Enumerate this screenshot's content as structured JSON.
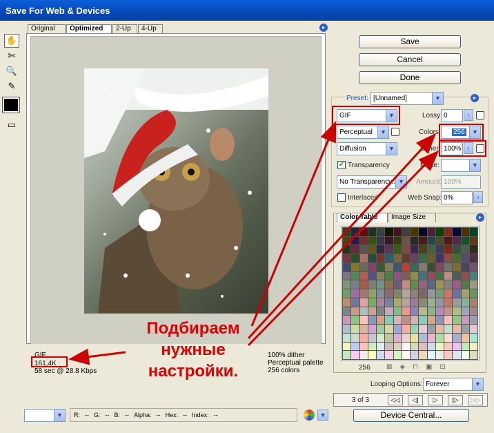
{
  "window": {
    "title": "Save For Web & Devices"
  },
  "tabs": [
    "Original",
    "Optimized",
    "2-Up",
    "4-Up"
  ],
  "buttons": {
    "save": "Save",
    "cancel": "Cancel",
    "done": "Done",
    "device_central": "Device Central..."
  },
  "settings": {
    "preset_label": "Preset:",
    "preset_value": "[Unnamed]",
    "format": "GIF",
    "lossy_label": "Lossy:",
    "lossy_value": "0",
    "reduction": "Perceptual",
    "colors_label": "Colors:",
    "colors_value": "256",
    "dither_algo": "Diffusion",
    "dither_label": "Dither:",
    "dither_value": "100%",
    "transparency_label": "Transparency",
    "transparency_checked": true,
    "matte_label": "Matte:",
    "matte_value": "",
    "transparency_dither": "No Transparency...",
    "amount_label": "Amount:",
    "amount_value": "100%",
    "interlaced_label": "Interlaced",
    "interlaced_checked": false,
    "websnap_label": "Web Snap:",
    "websnap_value": "0%"
  },
  "color_panel": {
    "tabs": [
      "Color Table",
      "Image Size"
    ],
    "count": "256"
  },
  "looping": {
    "label": "Looping Options:",
    "value": "Forever"
  },
  "frames": {
    "counter": "3 of 3"
  },
  "info": {
    "format": "GIF",
    "size": "161,4K",
    "time": "58 sec @ 28.8 Kbps",
    "dither": "100% dither",
    "palette": "Perceptual palette",
    "colors": "256 colors"
  },
  "statusbar": {
    "r": "R:",
    "r_val": "--",
    "g": "G:",
    "g_val": "--",
    "b": "B:",
    "b_val": "--",
    "alpha": "Alpha:",
    "alpha_val": "--",
    "hex": "Hex:",
    "hex_val": "--",
    "index": "Index:",
    "index_val": "--"
  },
  "caption": {
    "line1": "Подбираем",
    "line2": "нужные",
    "line3": "настройки."
  },
  "colors": {
    "annotation": "#cc0000",
    "titlebar": "#0648b8"
  }
}
